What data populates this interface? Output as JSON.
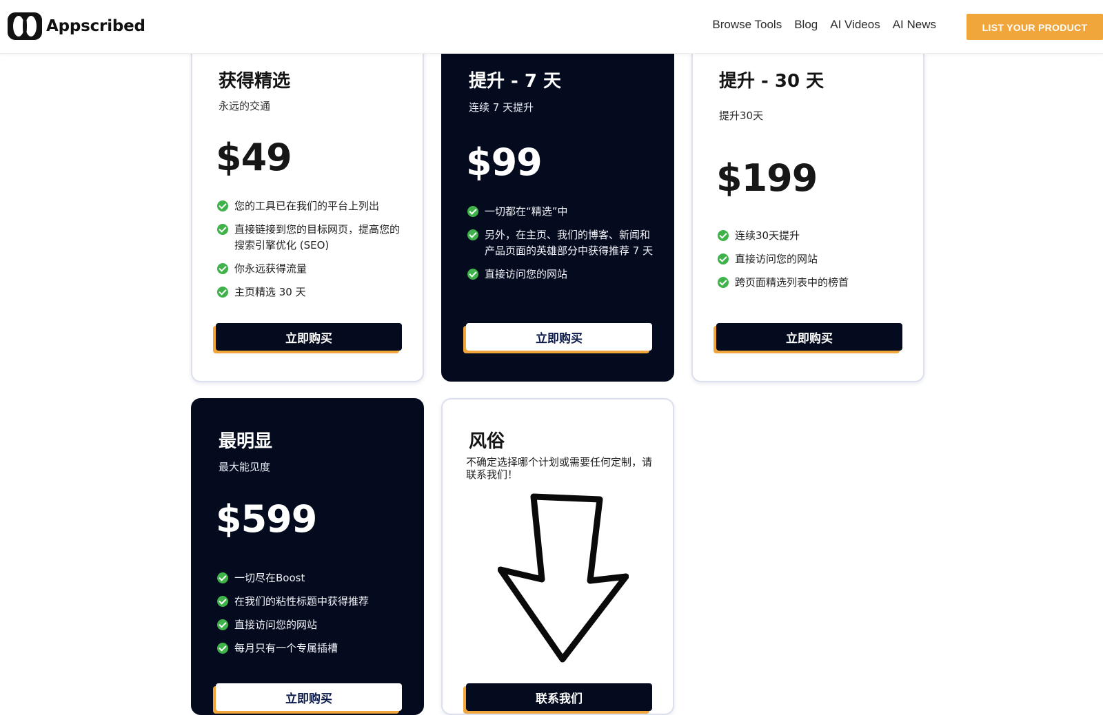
{
  "header": {
    "brand": "Appscribed",
    "nav": [
      "Browse Tools",
      "Blog",
      "AI Videos",
      "AI News"
    ],
    "cta_label": "LIST YOUR PRODUCT"
  },
  "colors": {
    "accent": "#f0a63a",
    "dark_card": "#050b1e",
    "check": "#3fb24a"
  },
  "plans": [
    {
      "title": "获得精选",
      "subtitle": "永远的交通",
      "price": "$49",
      "features": [
        "您的工具已在我们的平台上列出",
        "直接链接到您的目标网页，提高您的搜索引擎优化 (SEO)",
        "你永远获得流量",
        "主页精选 30 天"
      ],
      "button": "立即购买"
    },
    {
      "title": "提升 - 7 天",
      "subtitle": "连续 7 天提升",
      "price": "$99",
      "features": [
        "一切都在“精选”中",
        "另外，在主页、我们的博客、新闻和产品页面的英雄部分中获得推荐 7 天",
        "直接访问您的网站"
      ],
      "button": "立即购买"
    },
    {
      "title": "提升 - 30 天",
      "subtitle": "提升30天",
      "price": "$199",
      "features": [
        "连续30天提升",
        "直接访问您的网站",
        "跨页面精选列表中的榜首"
      ],
      "button": "立即购买"
    },
    {
      "title": "最明显",
      "subtitle": "最大能见度",
      "price": "$599",
      "features": [
        "一切尽在Boost",
        "在我们的粘性标题中获得推荐",
        "直接访问您的网站",
        "每月只有一个专属插槽"
      ],
      "button": "立即购买"
    }
  ],
  "custom": {
    "title": "风俗",
    "description": "不确定选择哪个计划或需要任何定制，请联系我们！",
    "button": "联系我们"
  }
}
